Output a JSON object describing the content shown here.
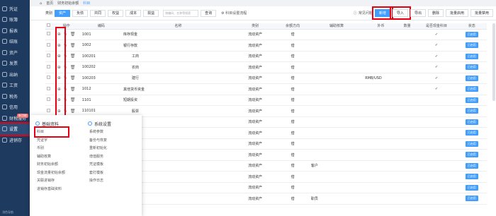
{
  "sidebar": {
    "items": [
      {
        "label": "凭证",
        "active": false
      },
      {
        "label": "账簿",
        "active": false
      },
      {
        "label": "报表",
        "active": false
      },
      {
        "label": "结账",
        "active": false
      },
      {
        "label": "资产",
        "active": false
      },
      {
        "label": "发票",
        "active": false
      },
      {
        "label": "出纳",
        "active": false
      },
      {
        "label": "工资",
        "active": false
      },
      {
        "label": "税务",
        "active": false
      },
      {
        "label": "信用",
        "active": false
      },
      {
        "label": "财税服务",
        "active": false
      },
      {
        "label": "设置",
        "active": true
      },
      {
        "label": "进销存",
        "active": false
      }
    ],
    "badge": "新功能",
    "footer": "浅色导航"
  },
  "topbar": {
    "tabs": [
      "首页",
      "财务初始余额",
      "科目"
    ]
  },
  "filters": [
    "类别",
    "资产",
    "负债",
    "共同",
    "权益",
    "成本",
    "损益"
  ],
  "search": {
    "placeholder": "按编码、名称等搜索"
  },
  "toolbar": {
    "query": "查询",
    "flow": "科目设置流程",
    "faq": "常见问题"
  },
  "actions": [
    "新增",
    "导入",
    "导出",
    "删除",
    "批量启用",
    "批量禁用"
  ],
  "table": {
    "headers": [
      "操作",
      "编码",
      "名称",
      "类别",
      "余额方向",
      "辅助核算",
      "外币",
      "数量",
      "是否现金科目",
      "状态"
    ],
    "status_label": "已启用",
    "rows": [
      {
        "code": "1001",
        "name": "库存现金",
        "type": "流动资产",
        "dir": "借",
        "aux": "",
        "fx": "",
        "qty": "",
        "cash": "✓",
        "status": true
      },
      {
        "code": "1002",
        "name": "银行存款",
        "type": "流动资产",
        "dir": "借",
        "aux": "",
        "fx": "",
        "qty": "",
        "cash": "✓",
        "status": true
      },
      {
        "code": "100201",
        "name": "工商",
        "type": "流动资产",
        "dir": "借",
        "aux": "",
        "fx": "",
        "qty": "",
        "cash": "✓",
        "status": true
      },
      {
        "code": "100202",
        "name": "农商",
        "type": "流动资产",
        "dir": "借",
        "aux": "",
        "fx": "",
        "qty": "",
        "cash": "✓",
        "status": true
      },
      {
        "code": "100203",
        "name": "建行",
        "type": "流动资产",
        "dir": "借",
        "aux": "",
        "fx": "RMB/USD",
        "qty": "",
        "cash": "✓",
        "status": true
      },
      {
        "code": "1012",
        "name": "其他货币资金",
        "type": "流动资产",
        "dir": "借",
        "aux": "",
        "fx": "",
        "qty": "",
        "cash": "✓",
        "status": true
      },
      {
        "code": "1101",
        "name": "短期投资",
        "type": "流动资产",
        "dir": "借",
        "aux": "",
        "fx": "",
        "qty": "",
        "cash": "",
        "status": true
      },
      {
        "code": "110101",
        "name": "股票",
        "type": "流动资产",
        "dir": "借",
        "aux": "",
        "fx": "",
        "qty": "",
        "cash": "",
        "status": true
      },
      {
        "code": "",
        "name": "",
        "type": "流动资产",
        "dir": "借",
        "aux": "",
        "fx": "",
        "qty": "",
        "cash": "",
        "status": true
      },
      {
        "code": "",
        "name": "",
        "type": "流动资产",
        "dir": "借",
        "aux": "",
        "fx": "",
        "qty": "",
        "cash": "",
        "status": true
      },
      {
        "code": "",
        "name": "",
        "type": "流动资产",
        "dir": "借",
        "aux": "",
        "fx": "",
        "qty": "",
        "cash": "",
        "status": true
      },
      {
        "code": "",
        "name": "",
        "type": "流动资产",
        "dir": "借",
        "aux": "",
        "fx": "",
        "qty": "",
        "cash": "",
        "status": true
      },
      {
        "code": "",
        "name": "",
        "type": "流动资产",
        "dir": "借",
        "aux": "客户",
        "fx": "",
        "qty": "",
        "cash": "",
        "status": true
      },
      {
        "code": "",
        "name": "",
        "type": "流动资产",
        "dir": "借",
        "aux": "",
        "fx": "",
        "qty": "",
        "cash": "",
        "status": true
      },
      {
        "code": "",
        "name": "",
        "type": "流动资产",
        "dir": "借",
        "aux": "",
        "fx": "",
        "qty": "",
        "cash": "",
        "status": true
      },
      {
        "code": "",
        "name": "",
        "type": "流动资产",
        "dir": "借",
        "aux": "职员",
        "fx": "",
        "qty": "",
        "cash": "",
        "status": true
      }
    ]
  },
  "menu": {
    "col1": {
      "title": "基础资料",
      "items": [
        "科目",
        "凭证字",
        "币别",
        "辅助核算",
        "财务初始余额",
        "现金流量初始余额",
        "关联进销存",
        "进销存基础资料"
      ]
    },
    "col2": {
      "title": "系统设置",
      "items": [
        "系统参数",
        "备份与恢复",
        "重新初始化",
        "增值服务",
        "凭证模板",
        "套打模板",
        "操作日志"
      ]
    }
  }
}
